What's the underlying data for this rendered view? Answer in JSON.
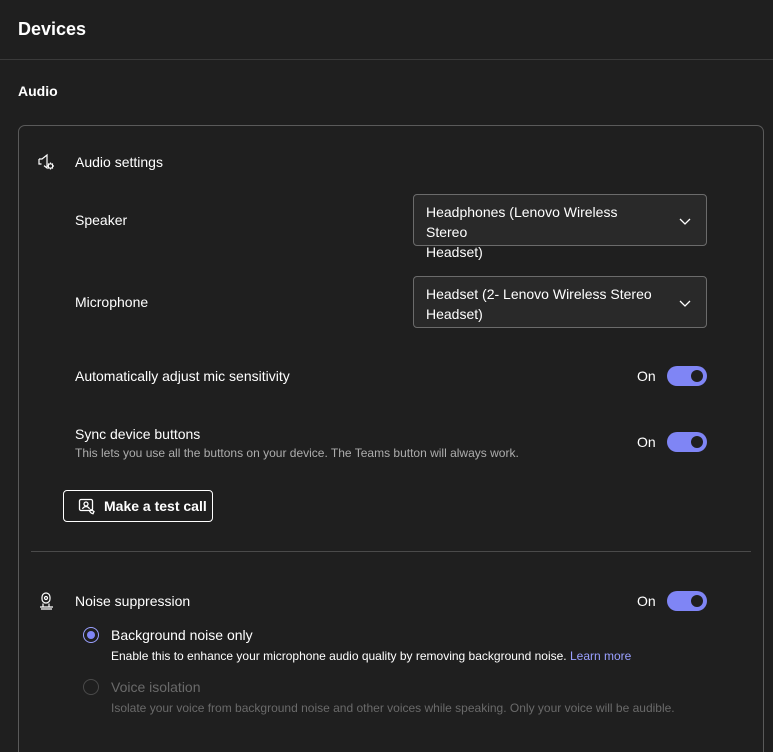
{
  "page": {
    "title": "Devices"
  },
  "audio": {
    "section_title": "Audio",
    "settings_header": "Audio settings",
    "speaker": {
      "label": "Speaker",
      "value_line1": "Headphones (Lenovo Wireless Stereo",
      "value_line2": "Headset)"
    },
    "microphone": {
      "label": "Microphone",
      "value_line1": "Headset (2- Lenovo Wireless Stereo",
      "value_line2": "Headset)"
    },
    "auto_adjust": {
      "label": "Automatically adjust mic sensitivity",
      "state": "On"
    },
    "sync_buttons": {
      "label": "Sync device buttons",
      "description": "This lets you use all the buttons on your device. The Teams button will always work.",
      "state": "On"
    },
    "test_call_label": "Make a test call"
  },
  "noise": {
    "label": "Noise suppression",
    "state": "On",
    "options": [
      {
        "label": "Background noise only",
        "description": "Enable this to enhance your microphone audio quality by removing background noise.",
        "link": "Learn more",
        "selected": true
      },
      {
        "label": "Voice isolation",
        "description": "Isolate your voice from background noise and other voices while speaking. Only your voice will be audible.",
        "selected": false,
        "disabled": true
      }
    ]
  },
  "colors": {
    "accent": "#7f85f5",
    "background": "#1f1f1f",
    "panel": "#292929"
  },
  "icons": [
    "speaker-settings-icon",
    "chevron-down-icon",
    "test-call-icon",
    "noise-suppression-icon"
  ]
}
